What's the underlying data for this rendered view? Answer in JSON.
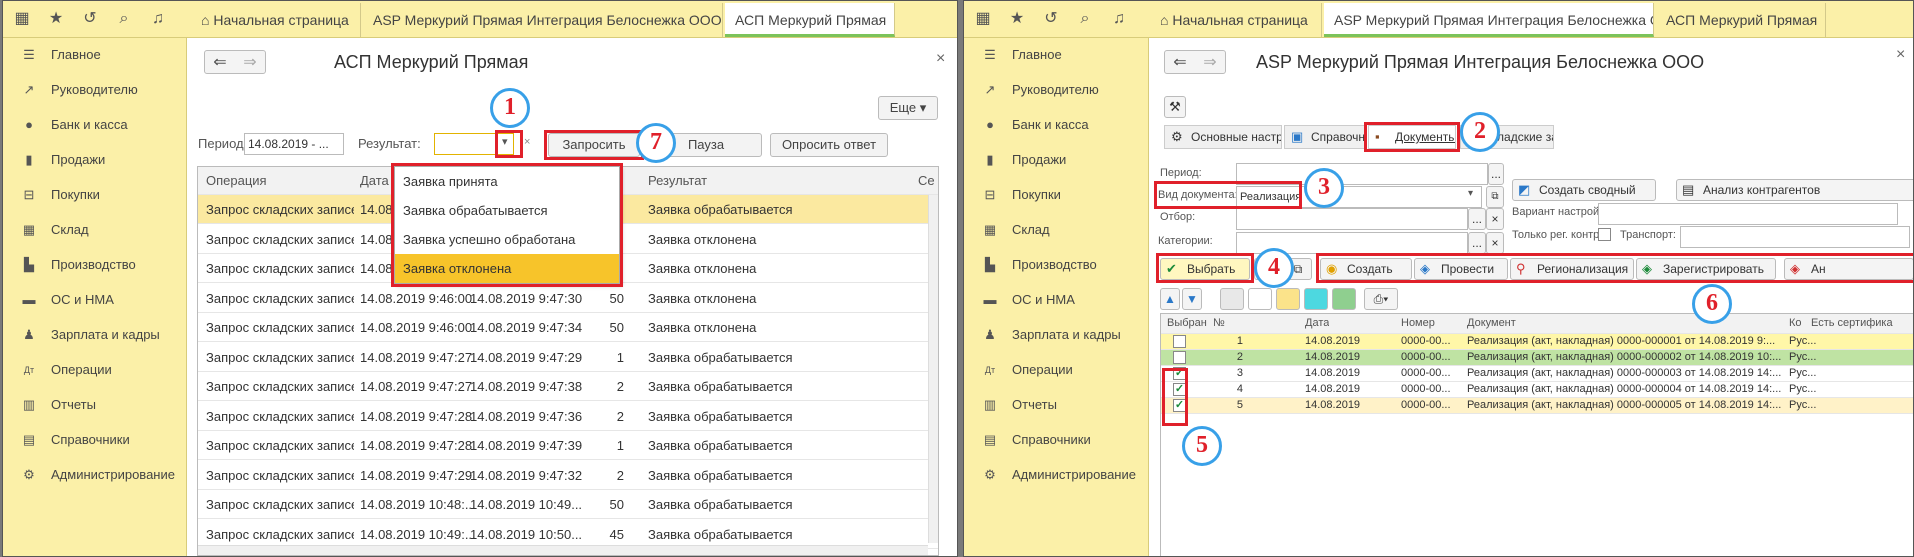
{
  "left": {
    "tabs": [
      {
        "label": "Начальная страница"
      },
      {
        "label": "ASP Меркурий Прямая Интеграция Белоснежка ООО"
      },
      {
        "label": "АСП Меркурий Прямая"
      }
    ],
    "sidebar": [
      {
        "label": "Главное",
        "icon": "menu-icon"
      },
      {
        "label": "Руководителю",
        "icon": "trend-icon"
      },
      {
        "label": "Банк и касса",
        "icon": "coin-icon"
      },
      {
        "label": "Продажи",
        "icon": "bag-icon"
      },
      {
        "label": "Покупки",
        "icon": "cart-icon"
      },
      {
        "label": "Склад",
        "icon": "warehouse-icon"
      },
      {
        "label": "Производство",
        "icon": "factory-icon"
      },
      {
        "label": "ОС и НМА",
        "icon": "truck-icon"
      },
      {
        "label": "Зарплата и кадры",
        "icon": "person-icon"
      },
      {
        "label": "Операции",
        "icon": "dt-kt-icon"
      },
      {
        "label": "Отчеты",
        "icon": "bar-chart-icon"
      },
      {
        "label": "Справочники",
        "icon": "book-icon"
      },
      {
        "label": "Администрирование",
        "icon": "gear-icon"
      }
    ],
    "title": "АСП Меркурий Прямая",
    "more_label": "Еще",
    "period_label": "Период:",
    "period_value": "14.08.2019 - ...",
    "result_label": "Результат:",
    "request_label": "Запросить",
    "pause_label": "Пауза",
    "poll_label": "Опросить ответ",
    "columns": [
      "Операция",
      "Дата с",
      "",
      "",
      "Результат",
      "Се"
    ],
    "rows": [
      {
        "op": "Запрос складских записей...",
        "d1": "14.08.",
        "d2": "",
        "n": "",
        "res": "Заявка обрабатывается"
      },
      {
        "op": "Запрос складских записей...",
        "d1": "14.08.",
        "d2": "",
        "n": "",
        "res": "Заявка отклонена"
      },
      {
        "op": "Запрос складских записей...",
        "d1": "14.08.",
        "d2": "",
        "n": "",
        "res": "Заявка отклонена"
      },
      {
        "op": "Запрос складских записей...",
        "d1": "14.08.2019 9:46:00",
        "d2": "14.08.2019 9:47:30",
        "n": "50",
        "res": "Заявка отклонена"
      },
      {
        "op": "Запрос складских записей...",
        "d1": "14.08.2019 9:46:00",
        "d2": "14.08.2019 9:47:34",
        "n": "50",
        "res": "Заявка отклонена"
      },
      {
        "op": "Запрос складских записей...",
        "d1": "14.08.2019 9:47:27",
        "d2": "14.08.2019 9:47:29",
        "n": "1",
        "res": "Заявка обрабатывается"
      },
      {
        "op": "Запрос складских записей...",
        "d1": "14.08.2019 9:47:27",
        "d2": "14.08.2019 9:47:38",
        "n": "2",
        "res": "Заявка обрабатывается"
      },
      {
        "op": "Запрос складских записей...",
        "d1": "14.08.2019 9:47:28",
        "d2": "14.08.2019 9:47:36",
        "n": "2",
        "res": "Заявка обрабатывается"
      },
      {
        "op": "Запрос складских записей...",
        "d1": "14.08.2019 9:47:28",
        "d2": "14.08.2019 9:47:39",
        "n": "1",
        "res": "Заявка обрабатывается"
      },
      {
        "op": "Запрос складских записей...",
        "d1": "14.08.2019 9:47:29",
        "d2": "14.08.2019 9:47:32",
        "n": "2",
        "res": "Заявка обрабатывается"
      },
      {
        "op": "Запрос складских записей...",
        "d1": "14.08.2019 10:48:...",
        "d2": "14.08.2019 10:49...",
        "n": "50",
        "res": "Заявка обрабатывается"
      },
      {
        "op": "Запрос складских записей...",
        "d1": "14.08.2019 10:49:...",
        "d2": "14.08.2019 10:50...",
        "n": "45",
        "res": "Заявка обрабатывается"
      }
    ],
    "dropdown": [
      "Заявка принята",
      "Заявка обрабатывается",
      "Заявка успешно обработана",
      "Заявка отклонена"
    ]
  },
  "right": {
    "tabs": [
      {
        "label": "Начальная страница"
      },
      {
        "label": "ASP Меркурий Прямая Интеграция Белоснежка ООО"
      },
      {
        "label": "АСП Меркурий Прямая"
      }
    ],
    "title": "ASP Меркурий Прямая Интеграция Белоснежка ООО",
    "form_tabs": [
      "Основные настройки",
      "Справочники",
      "Документы",
      "Складские записи"
    ],
    "period_label": "Период:",
    "doc_type_label": "Вид документа:",
    "doc_type_value": "Реализация",
    "filter_label": "Отбор:",
    "categories_label": "Категории:",
    "create_summary_label": "Создать сводный",
    "analysis_label": "Анализ контрагентов",
    "variant_label": "Вариант настройки:",
    "only_reg_label": "Только рег. контр.:",
    "transport_label": "Транспорт:",
    "select_label": "Выбрать",
    "create_label": "Создать",
    "post_label": "Провести",
    "regionalize_label": "Регионализация",
    "register_label": "Зарегистрировать",
    "cancel_label": "Ан",
    "columns": [
      "Выбран",
      "№",
      "Дата",
      "Номер",
      "Документ",
      "Ко",
      "Есть сертифика"
    ],
    "rows": [
      {
        "checked": false,
        "n": "1",
        "date": "14.08.2019",
        "num": "0000-00...",
        "doc": "Реализация (акт, накладная) 0000-000001 от 14.08.2019 9:...",
        "k": "Рус..."
      },
      {
        "checked": false,
        "n": "2",
        "date": "14.08.2019",
        "num": "0000-00...",
        "doc": "Реализация (акт, накладная) 0000-000002 от 14.08.2019 10:...",
        "k": "Рус..."
      },
      {
        "checked": true,
        "n": "3",
        "date": "14.08.2019",
        "num": "0000-00...",
        "doc": "Реализация (акт, накладная) 0000-000003 от 14.08.2019 14:...",
        "k": "Рус..."
      },
      {
        "checked": true,
        "n": "4",
        "date": "14.08.2019",
        "num": "0000-00...",
        "doc": "Реализация (акт, накладная) 0000-000004 от 14.08.2019 14:...",
        "k": "Рус..."
      },
      {
        "checked": true,
        "n": "5",
        "date": "14.08.2019",
        "num": "0000-00...",
        "doc": "Реализация (акт, накладная) 0000-000005 от 14.08.2019 14:...",
        "k": "Рус..."
      }
    ]
  },
  "callouts": [
    "1",
    "7",
    "2",
    "3",
    "4",
    "5",
    "6"
  ],
  "colors": {
    "accent_yellow": "#fbf0a8",
    "selected_row": "#fbe9a0",
    "green_row": "#bfe3a3",
    "callout_red": "#e0202a",
    "callout_blue": "#38a0e8"
  }
}
